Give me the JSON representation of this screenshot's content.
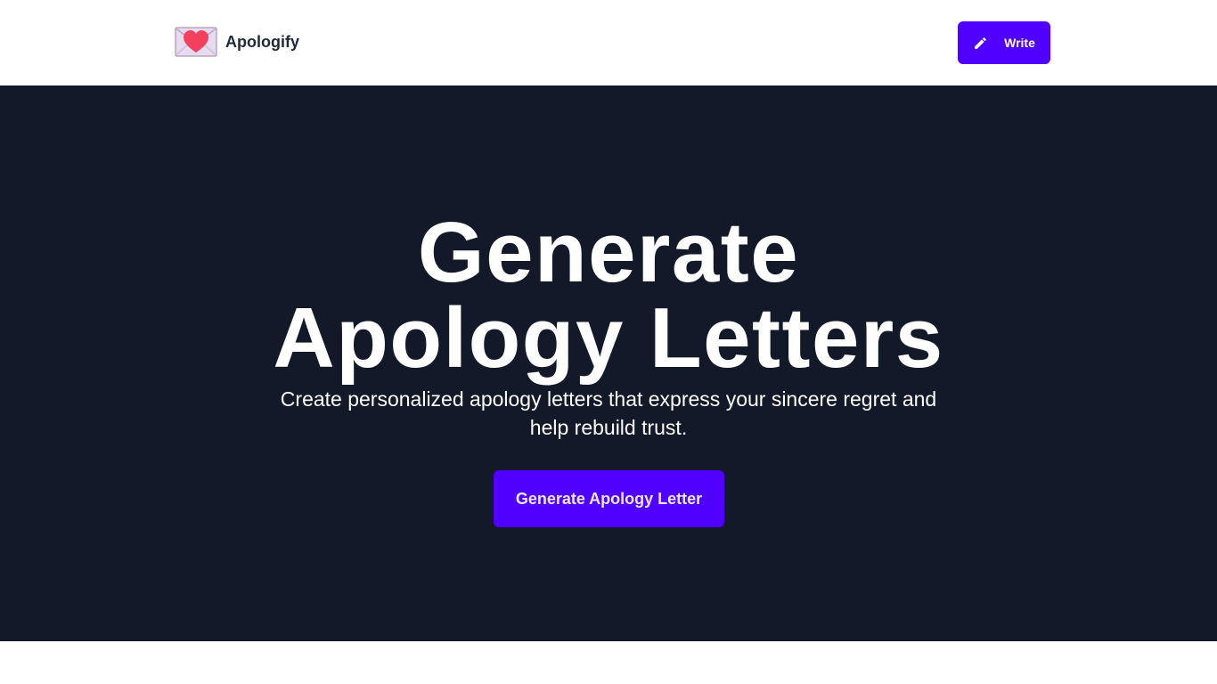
{
  "header": {
    "brand_name": "Apologify",
    "logo_icon": "love-letter-envelope-icon",
    "write_button": {
      "label": "Write",
      "icon": "pencil-icon"
    }
  },
  "hero": {
    "title_line_1": "Generate",
    "title_line_2": "Apology Letters",
    "subtitle": "Create personalized apology letters that express your sincere regret and help rebuild trust.",
    "cta_label": "Generate Apology Letter"
  },
  "colors": {
    "accent": "#5000ff",
    "hero_background": "#131929",
    "brand_text": "#1f2937",
    "heart": "#f43f5e"
  }
}
